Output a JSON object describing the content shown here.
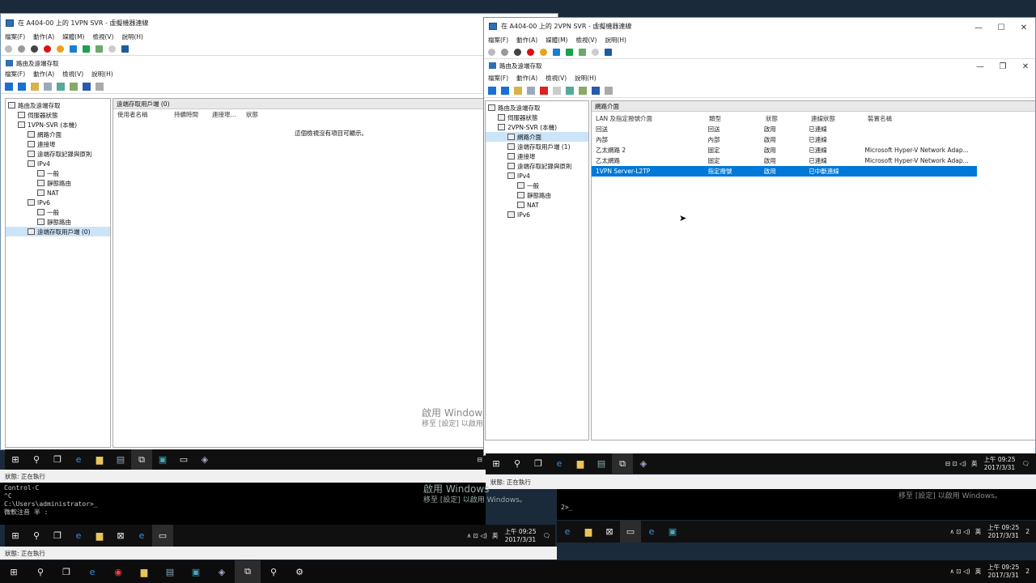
{
  "left_window": {
    "title": "在 A404-00 上的 1VPN SVR - 虛擬機器連線",
    "menu": [
      "檔案(F)",
      "動作(A)",
      "媒體(M)",
      "檢視(V)",
      "說明(H)"
    ],
    "inner_title": "路由及遠端存取",
    "inner_menu": [
      "檔案(F)",
      "動作(A)",
      "檢視(V)",
      "說明(H)"
    ],
    "tree": [
      {
        "label": "路由及遠端存取",
        "indent": 0
      },
      {
        "label": "伺服器狀態",
        "indent": 1
      },
      {
        "label": "1VPN-SVR (本機)",
        "indent": 1
      },
      {
        "label": "網路介面",
        "indent": 2
      },
      {
        "label": "連接埠",
        "indent": 2
      },
      {
        "label": "遠端存取記錄與原則",
        "indent": 2
      },
      {
        "label": "IPv4",
        "indent": 2
      },
      {
        "label": "一般",
        "indent": 3
      },
      {
        "label": "靜態路由",
        "indent": 3
      },
      {
        "label": "NAT",
        "indent": 3
      },
      {
        "label": "IPv6",
        "indent": 2
      },
      {
        "label": "一般",
        "indent": 3
      },
      {
        "label": "靜態路由",
        "indent": 3
      },
      {
        "label": "遠端存取用戶端 (0)",
        "indent": 2
      }
    ],
    "pane_title": "遠端存取用戶端 (0)",
    "columns": [
      "使用者名稱",
      "持續時間",
      "連接埠...",
      "狀態"
    ],
    "empty_message": "這個檢視沒有項目可顯示。",
    "status": "狀態: 正在執行"
  },
  "right_window": {
    "title": "在 A404-00 上的 2VPN SVR - 虛擬機器連線",
    "menu": [
      "檔案(F)",
      "動作(A)",
      "媒體(M)",
      "檢視(V)",
      "說明(H)"
    ],
    "inner_title": "路由及遠端存取",
    "inner_menu": [
      "檔案(F)",
      "動作(A)",
      "檢視(V)",
      "說明(H)"
    ],
    "tree": [
      {
        "label": "路由及遠端存取",
        "indent": 0
      },
      {
        "label": "伺服器狀態",
        "indent": 1
      },
      {
        "label": "2VPN-SVR (本機)",
        "indent": 1
      },
      {
        "label": "網路介面",
        "indent": 2
      },
      {
        "label": "遠端存取用戶端 (1)",
        "indent": 2
      },
      {
        "label": "連接埠",
        "indent": 2
      },
      {
        "label": "遠端存取記錄與原則",
        "indent": 2
      },
      {
        "label": "IPv4",
        "indent": 2
      },
      {
        "label": "一般",
        "indent": 3
      },
      {
        "label": "靜態路由",
        "indent": 3
      },
      {
        "label": "NAT",
        "indent": 3
      },
      {
        "label": "IPv6",
        "indent": 2
      }
    ],
    "pane_title": "網路介面",
    "columns": [
      "LAN 及指定撥號介面",
      "類型",
      "狀態",
      "連線狀態",
      "裝置名稱"
    ],
    "rows": [
      [
        "回送",
        "回送",
        "啟用",
        "已連線",
        ""
      ],
      [
        "內部",
        "內部",
        "啟用",
        "已連線",
        ""
      ],
      [
        "乙太網路 2",
        "固定",
        "啟用",
        "已連線",
        "Microsoft Hyper-V Network Adap..."
      ],
      [
        "乙太網路",
        "固定",
        "啟用",
        "已連線",
        "Microsoft Hyper-V Network Adap..."
      ],
      [
        "1VPN Server-L2TP",
        "指定撥號",
        "啟用",
        "已中斷連線",
        ""
      ]
    ],
    "status": "狀態: 正在執行"
  },
  "taskbars": {
    "vm_left": {
      "time": "上午 09:25",
      "date": "2017/3/31",
      "ime": "英"
    },
    "vm_right": {
      "time": "上午 09:25",
      "date": "2017/3/31",
      "ime": "英",
      "notif": "2"
    },
    "lower_left": {
      "time": "上午 09:25",
      "date": "2017/3/31",
      "ime": "英"
    },
    "lower_right": {
      "time": "上午 09:25",
      "date": "2017/3/31",
      "ime": "英",
      "notif": "2"
    },
    "host": {
      "time": "上午 09:25",
      "date": "2017/3/31",
      "ime": "英",
      "notif": "2"
    }
  },
  "watermark": {
    "line1": "啟用 Windows",
    "line2": "移至 [設定] 以啟用 Windows。"
  },
  "cmd_left": [
    "Control-C",
    "^C",
    "C:\\Users\\administrator>_",
    "微軟注音 半 :"
  ],
  "cmd_right": [
    "2>_"
  ],
  "lower_status": "狀態: 正在執行"
}
